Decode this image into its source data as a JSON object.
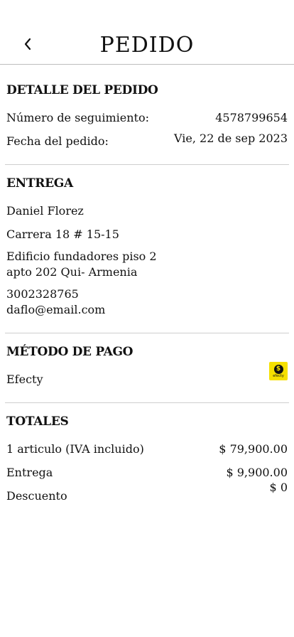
{
  "header": {
    "title": "PEDIDO",
    "back_icon": "chevron-left-icon"
  },
  "order_detail": {
    "title": "DETALLE DEL PEDIDO",
    "tracking_label": "Número de seguimiento:",
    "tracking_value": "4578799654",
    "date_label": "Fecha del pedido:",
    "date_value": "Vie, 22 de sep 2023"
  },
  "delivery": {
    "title": "ENTREGA",
    "name": "Daniel Florez",
    "address_line1": "Carrera 18 # 15-15",
    "address_line2": "Edificio fundadores piso 2",
    "address_line3": "apto 202 Qui- Armenia",
    "phone": "3002328765",
    "email": "daflo@email.com"
  },
  "payment": {
    "title": "MÉTODO DE PAGO",
    "method": "Efecty",
    "logo_text": "efecty",
    "logo_icon": "efecty-logo",
    "logo_color": "#f5e000"
  },
  "totals": {
    "title": "TOTALES",
    "items_label": "1 articulo (IVA incluido)",
    "items_value": "$ 79,900.00",
    "delivery_label": "Entrega",
    "delivery_value": "$ 9,900.00",
    "discount_label": "Descuento",
    "discount_value": "$ 0"
  }
}
